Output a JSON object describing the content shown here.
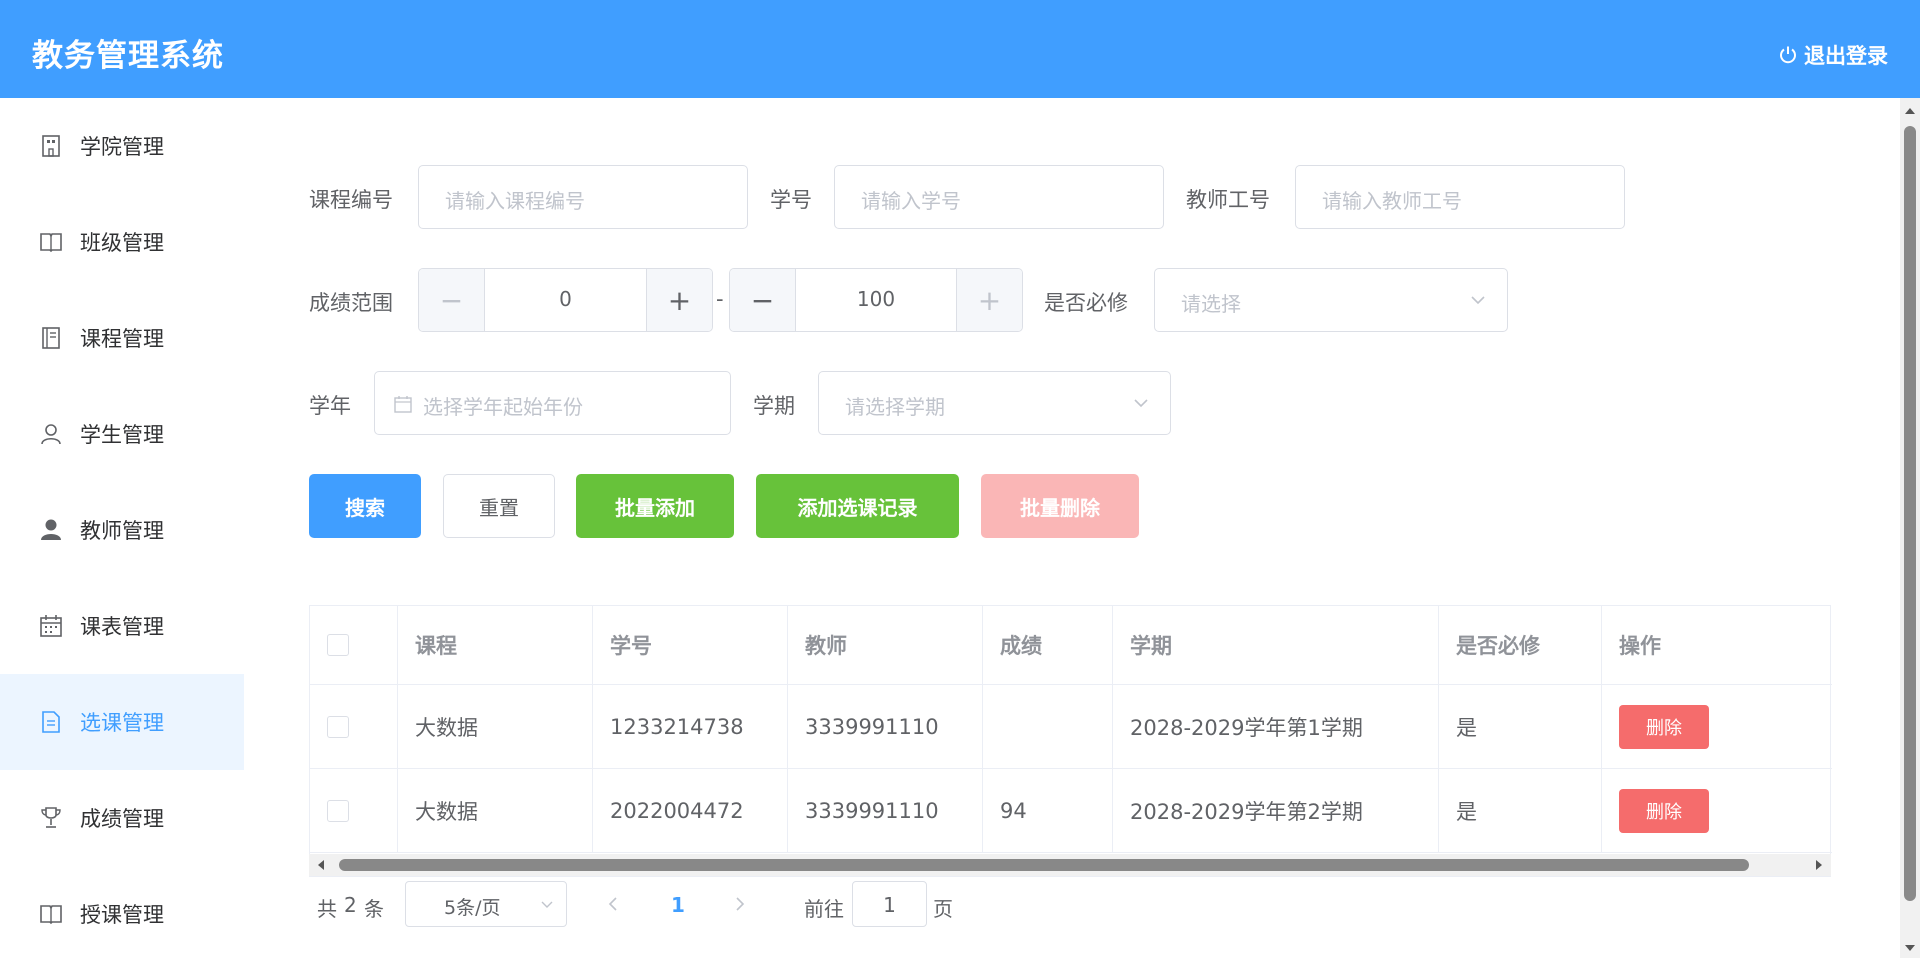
{
  "header": {
    "title": "教务管理系统",
    "logout_label": "退出登录"
  },
  "sidebar": {
    "items": [
      {
        "label": "学院管理",
        "icon": "building-icon"
      },
      {
        "label": "班级管理",
        "icon": "book-icon"
      },
      {
        "label": "课程管理",
        "icon": "notebook-icon"
      },
      {
        "label": "学生管理",
        "icon": "user-icon"
      },
      {
        "label": "教师管理",
        "icon": "user-filled-icon"
      },
      {
        "label": "课表管理",
        "icon": "calendar-icon"
      },
      {
        "label": "选课管理",
        "icon": "document-icon",
        "active": true
      },
      {
        "label": "成绩管理",
        "icon": "trophy-icon"
      },
      {
        "label": "授课管理",
        "icon": "book-icon"
      }
    ]
  },
  "filters": {
    "course_id_label": "课程编号",
    "course_id_placeholder": "请输入课程编号",
    "student_id_label": "学号",
    "student_id_placeholder": "请输入学号",
    "teacher_id_label": "教师工号",
    "teacher_id_placeholder": "请输入教师工号",
    "score_range_label": "成绩范围",
    "score_min": "0",
    "score_max": "100",
    "range_sep": "-",
    "required_label": "是否必修",
    "required_placeholder": "请选择",
    "year_label": "学年",
    "year_placeholder": "选择学年起始年份",
    "term_label": "学期",
    "term_placeholder": "请选择学期"
  },
  "actions": {
    "search": "搜索",
    "reset": "重置",
    "batch_add": "批量添加",
    "add_record": "添加选课记录",
    "batch_delete": "批量删除"
  },
  "table": {
    "columns": [
      "课程",
      "学号",
      "教师",
      "成绩",
      "学期",
      "是否必修",
      "操作"
    ],
    "rows": [
      {
        "course": "大数据",
        "student_id": "1233214738",
        "teacher": "3339991110",
        "score": "",
        "term": "2028-2029学年第1学期",
        "required": "是",
        "action": "删除"
      },
      {
        "course": "大数据",
        "student_id": "2022004472",
        "teacher": "3339991110",
        "score": "94",
        "term": "2028-2029学年第2学期",
        "required": "是",
        "action": "删除"
      }
    ]
  },
  "pagination": {
    "total_prefix": "共",
    "total": "2",
    "total_suffix": "条",
    "page_size": "5条/页",
    "current_page": "1",
    "goto_prefix": "前往",
    "goto_value": "1",
    "goto_suffix": "页"
  },
  "colors": {
    "primary": "#409eff",
    "success": "#67c23a",
    "danger": "#f56c6c",
    "danger_disabled": "#fab6b6"
  }
}
